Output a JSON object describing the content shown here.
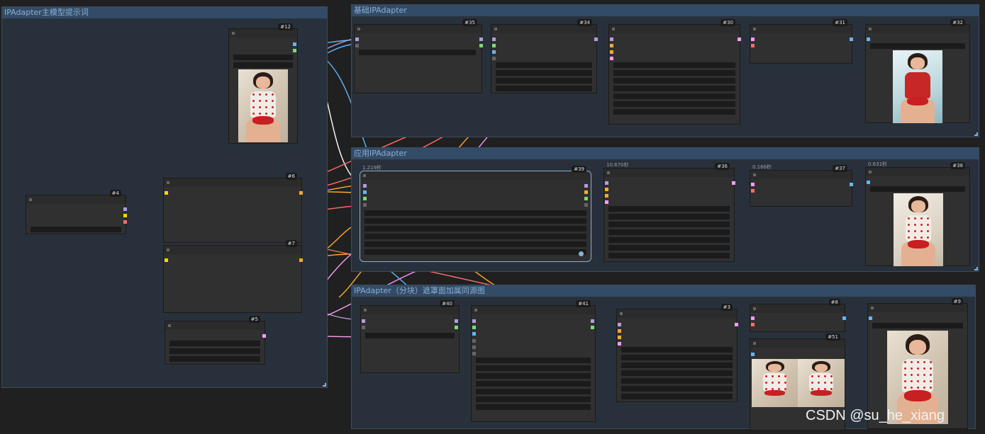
{
  "groups": [
    {
      "title": "IPAdapter主模型提示词"
    },
    {
      "title": "基础IPAdapter"
    },
    {
      "title": "应用IPAdapter"
    },
    {
      "title": "IPAdapter（分块）遮罩面加属同源图"
    }
  ],
  "nodes": {
    "n12": {
      "badge": "#12"
    },
    "n4": {
      "badge": "#4"
    },
    "n6": {
      "badge": "#6"
    },
    "n7": {
      "badge": "#7"
    },
    "n5": {
      "badge": "#5"
    },
    "n35": {
      "badge": "#35"
    },
    "n34": {
      "badge": "#34"
    },
    "n30": {
      "badge": "#30"
    },
    "n31": {
      "badge": "#31"
    },
    "n32": {
      "badge": "#32"
    },
    "n39": {
      "badge": "#39",
      "time": "1.219秒"
    },
    "n36": {
      "badge": "#36",
      "time": "10.670秒"
    },
    "n37": {
      "badge": "#37",
      "time": "0.166秒"
    },
    "n38": {
      "badge": "#38",
      "time": "0.631秒"
    },
    "n40": {
      "badge": "#40"
    },
    "n41": {
      "badge": "#41"
    },
    "n3": {
      "badge": "#3"
    },
    "n8": {
      "badge": "#8"
    },
    "n9": {
      "badge": "#9"
    },
    "n51": {
      "badge": "#51"
    }
  },
  "wire_colors": {
    "clip": "#ffd500",
    "conditioning": "#ffa931",
    "model": "#b39ddb",
    "image": "#64b5f6",
    "latent": "#ff9cf9",
    "vae": "#ff6e6e",
    "white": "#ffffff"
  },
  "watermark": "CSDN @su_he_xiang"
}
